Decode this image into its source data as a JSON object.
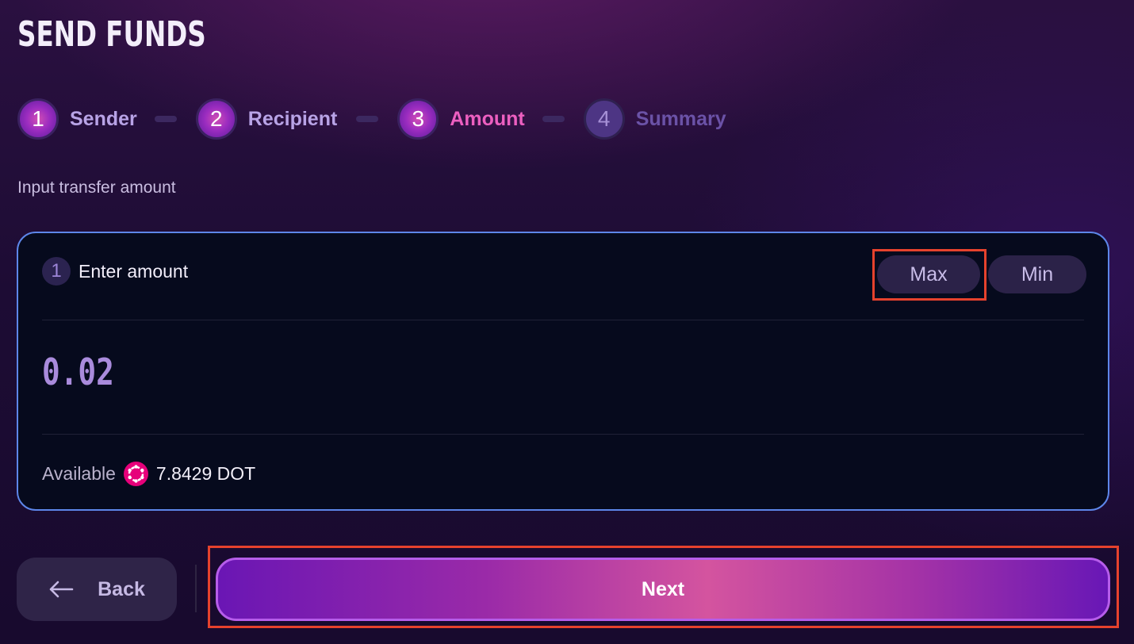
{
  "page": {
    "title": "SEND FUNDS",
    "subtitle": "Input transfer amount"
  },
  "stepper": {
    "steps": [
      {
        "number": "1",
        "label": "Sender",
        "state": "done"
      },
      {
        "number": "2",
        "label": "Recipient",
        "state": "done"
      },
      {
        "number": "3",
        "label": "Amount",
        "state": "active"
      },
      {
        "number": "4",
        "label": "Summary",
        "state": "pending"
      }
    ]
  },
  "amount_card": {
    "step_number": "1",
    "title": "Enter amount",
    "max_label": "Max",
    "min_label": "Min",
    "amount_value": "0.02",
    "available_label": "Available",
    "available_icon": "polkadot-icon",
    "available_value": "7.8429 DOT"
  },
  "actions": {
    "back_label": "Back",
    "back_icon": "arrow-left-icon",
    "next_label": "Next"
  },
  "colors": {
    "accent_pink": "#ec5fc0",
    "card_border": "#5d86e9",
    "highlight": "#e6422d",
    "polkadot": "#e6007a"
  }
}
